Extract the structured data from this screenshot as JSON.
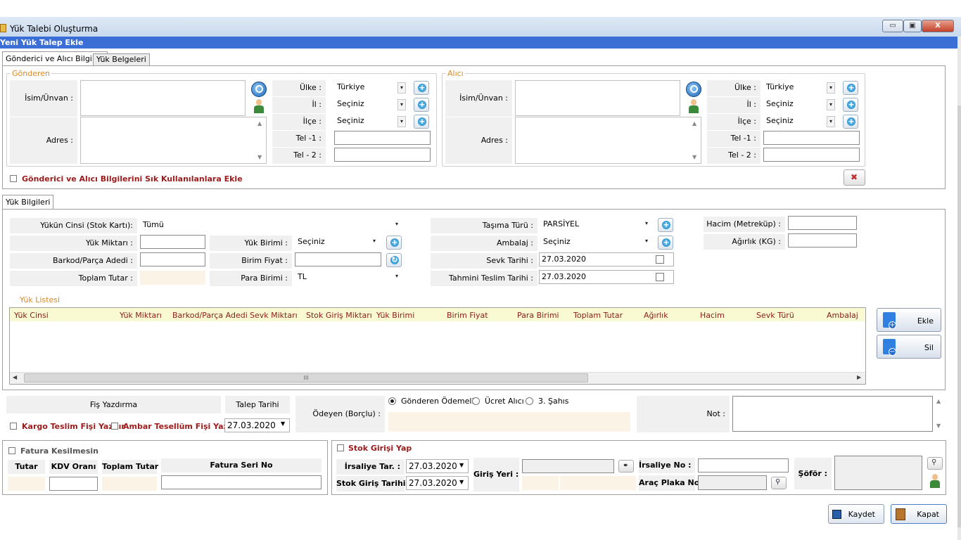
{
  "window": {
    "title": "Yük Talebi Oluşturma",
    "header": "Yeni Yük Talep Ekle",
    "min_label": "▭",
    "max_label": "▣",
    "close_label": "X"
  },
  "tabs": {
    "main": [
      "Gönderici ve Alıcı Bilgileri",
      "Yük Belgeleri"
    ],
    "cargo": "Yük Bilgileri"
  },
  "sender": {
    "legend": "Gönderen",
    "name_label": "İsim/Ünvan :",
    "address_label": "Adres :",
    "country_label": "Ülke :",
    "country_value": "Türkiye",
    "city_label": "İl :",
    "city_value": "Seçiniz",
    "district_label": "İlçe :",
    "district_value": "Seçiniz",
    "tel1_label": "Tel -1 :",
    "tel2_label": "Tel - 2 :"
  },
  "receiver": {
    "legend": "Alıcı",
    "name_label": "İsim/Ünvan :",
    "address_label": "Adres :",
    "country_label": "Ülke :",
    "country_value": "Türkiye",
    "city_label": "İl :",
    "city_value": "Seçiniz",
    "district_label": "İlçe :",
    "district_value": "Seçiniz",
    "tel1_label": "Tel -1 :",
    "tel2_label": "Tel - 2 :"
  },
  "favorites_checkbox": "Gönderici ve Alıcı Bilgilerini Sık Kullanılanlara Ekle",
  "cargo": {
    "type_label": "Yükün Cinsi (Stok Kartı):",
    "type_value": "Tümü",
    "qty_label": "Yük Miktarı :",
    "barcode_label": "Barkod/Parça Adedi :",
    "total_label": "Toplam Tutar :",
    "unit_label": "Yük Birimi :",
    "unit_value": "Seçiniz",
    "unit_price_label": "Birim Fiyat :",
    "currency_label": "Para Birimi :",
    "currency_value": "TL",
    "transport_label": "Taşıma Türü :",
    "transport_value": "PARSİYEL",
    "package_label": "Ambalaj :",
    "package_value": "Seçiniz",
    "ship_date_label": "Sevk Tarihi :",
    "ship_date_value": "27.03.2020",
    "delivery_label": "Tahmini Teslim Tarihi :",
    "delivery_value": "27.03.2020",
    "volume_label": "Hacim (Metreküp) :",
    "weight_label": "Ağırlık (KG) :"
  },
  "list": {
    "title": "Yük Listesi",
    "columns": [
      "Yük Cinsi",
      "Yük Miktarı",
      "Barkod/Parça Adedi",
      "Sevk Miktarı",
      "Stok Giriş Miktarı",
      "Yük Birimi",
      "Birim Fiyat",
      "Para Birimi",
      "Toplam Tutar",
      "Ağırlık",
      "Hacim",
      "Sevk Türü",
      "Ambalaj"
    ],
    "add_label": "Ekle",
    "remove_label": "Sil",
    "scroll_grip": "III"
  },
  "print": {
    "title": "Fiş Yazdırma",
    "cargo_slip": "Kargo Teslim Fişi Yazdır",
    "depot_slip": "Ambar Tesellüm Fişi Yazdır",
    "request_date_label": "Talep Tarihi",
    "request_date_value": "27.03.2020"
  },
  "payer": {
    "label": "Ödeyen (Borçlu) :",
    "options": [
      "Gönderen Ödemeli",
      "Ücret Alıcı",
      "3. Şahıs"
    ]
  },
  "note_label": "Not :",
  "invoice": {
    "no_invoice": "Fatura Kesilmesin",
    "total": "Tutar",
    "vat": "KDV Oranı",
    "grand_total": "Toplam Tutar",
    "serial": "Fatura Seri No"
  },
  "stock": {
    "entry": "Stok Girişi Yap",
    "waybill_date_label": "İrsaliye Tar. :",
    "waybill_date_value": "27.03.2020",
    "entry_date_label": "Stok Giriş Tarihi :",
    "entry_date_value": "27.03.2020",
    "entry_place_label": "Giriş Yeri :",
    "waybill_no_label": "İrsaliye No :",
    "plate_label": "Araç Plaka No:",
    "driver_label": "Şöför :"
  },
  "actions": {
    "save": "Kaydet",
    "close": "Kapat"
  }
}
